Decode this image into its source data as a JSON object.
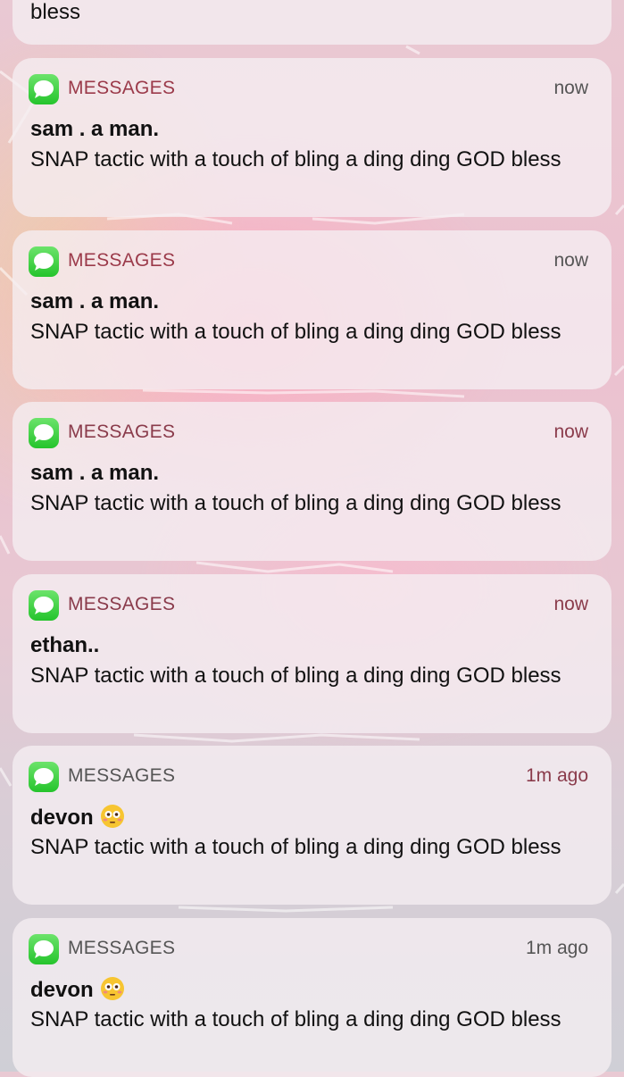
{
  "colors": {
    "app_name_red": "#9b3a4a",
    "app_name_gray": "#555555",
    "time_red": "#8a3b4b",
    "time_gray": "#555555",
    "messages_green": "#34c759"
  },
  "partial": {
    "text": "bless"
  },
  "notifications": [
    {
      "app": "MESSAGES",
      "time": "now",
      "sender": "sam . a man.",
      "body": "SNAP tactic with a touch of bling a ding ding GOD bless"
    },
    {
      "app": "MESSAGES",
      "time": "now",
      "sender": "sam . a man.",
      "body": "SNAP tactic with a touch of bling a ding ding GOD bless"
    },
    {
      "app": "MESSAGES",
      "time": "now",
      "sender": "sam . a man.",
      "body": "SNAP tactic with a touch of bling a ding ding GOD bless"
    },
    {
      "app": "MESSAGES",
      "time": "now",
      "sender": "ethan..",
      "body": "SNAP tactic with a touch of bling a ding ding GOD bless"
    },
    {
      "app": "MESSAGES",
      "time": "1m ago",
      "sender": "devon",
      "sender_icon": "flushed-face-emoji",
      "body": "SNAP tactic with a touch of bling a ding ding GOD bless"
    },
    {
      "app": "MESSAGES",
      "time": "1m ago",
      "sender": "devon",
      "sender_icon": "flushed-face-emoji",
      "body": "SNAP tactic with a touch of bling a ding ding GOD bless"
    }
  ]
}
